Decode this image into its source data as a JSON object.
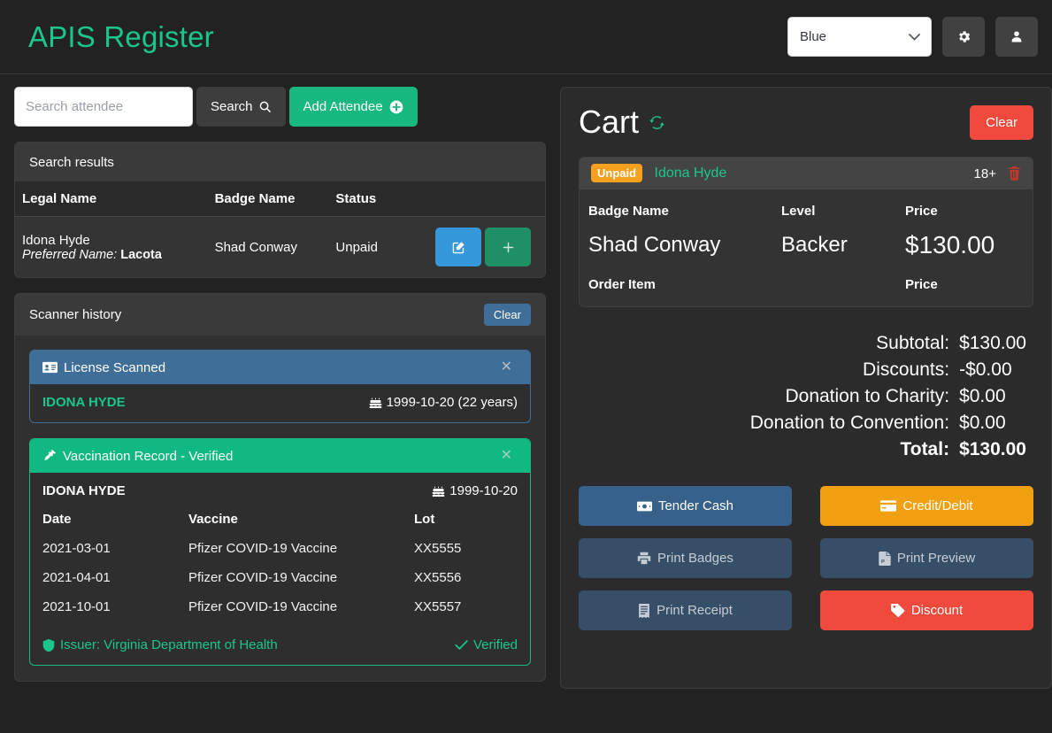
{
  "header": {
    "title": "APIS Register",
    "theme_select_value": "Blue",
    "theme_options": [
      "Blue"
    ],
    "settings_icon": "gear-icon",
    "account_icon": "user-icon"
  },
  "search": {
    "placeholder": "Search attendee",
    "value": "",
    "search_button": "Search",
    "search_icon": "magnifier-icon",
    "add_button": "Add Attendee",
    "add_icon": "plus-circle-icon"
  },
  "search_results": {
    "panel_title": "Search results",
    "columns": [
      "Legal Name",
      "Badge Name",
      "Status"
    ],
    "rows": [
      {
        "legal_name": "Idona Hyde",
        "preferred_label": "Preferred Name:",
        "preferred_name": "Lacota",
        "badge_name": "Shad Conway",
        "status": "Unpaid",
        "edit_icon": "pencil-square-icon",
        "add_icon": "plus-icon"
      }
    ]
  },
  "scanner_history": {
    "panel_title": "Scanner history",
    "clear_button": "Clear",
    "license_card": {
      "icon": "id-card-icon",
      "title": "License Scanned",
      "close_icon": "close-icon",
      "name": "IDONA HYDE",
      "dob_icon": "birthday-cake-icon",
      "dob": "1999-10-20 (22 years)"
    },
    "vaccine_card": {
      "icon": "syringe-icon",
      "title": "Vaccination Record - Verified",
      "close_icon": "close-icon",
      "name": "IDONA HYDE",
      "dob_icon": "birthday-cake-icon",
      "dob": "1999-10-20",
      "columns": [
        "Date",
        "Vaccine",
        "Lot"
      ],
      "records": [
        {
          "date": "2021-03-01",
          "vaccine": "Pfizer COVID-19 Vaccine",
          "lot": "XX5555"
        },
        {
          "date": "2021-04-01",
          "vaccine": "Pfizer COVID-19 Vaccine",
          "lot": "XX5556"
        },
        {
          "date": "2021-10-01",
          "vaccine": "Pfizer COVID-19 Vaccine",
          "lot": "XX5557"
        }
      ],
      "issuer_icon": "shield-icon",
      "issuer": "Issuer: Virginia Department of Health",
      "verified_icon": "check-icon",
      "verified": "Verified"
    }
  },
  "cart": {
    "title": "Cart",
    "sync_icon": "sync-icon",
    "clear_button": "Clear",
    "item": {
      "status_badge": "Unpaid",
      "attendee_name": "Idona Hyde",
      "age_flag": "18+",
      "delete_icon": "trash-icon",
      "columns": [
        "Badge Name",
        "Level",
        "Price"
      ],
      "badge_name": "Shad Conway",
      "level": "Backer",
      "price": "$130.00",
      "order_item_label": "Order Item",
      "order_price_label": "Price"
    },
    "totals": [
      {
        "label": "Subtotal:",
        "value": "$130.00"
      },
      {
        "label": "Discounts:",
        "value": "-$0.00"
      },
      {
        "label": "Donation to Charity:",
        "value": "$0.00"
      },
      {
        "label": "Donation to Convention:",
        "value": "$0.00"
      },
      {
        "label": "Total:",
        "value": "$130.00"
      }
    ],
    "actions": [
      {
        "label": "Tender Cash",
        "icon": "money-bill-icon",
        "style": "blue"
      },
      {
        "label": "Credit/Debit",
        "icon": "credit-card-icon",
        "style": "orange"
      },
      {
        "label": "Print Badges",
        "icon": "printer-icon",
        "style": "navy"
      },
      {
        "label": "Print Preview",
        "icon": "file-pdf-icon",
        "style": "navy"
      },
      {
        "label": "Print Receipt",
        "icon": "receipt-icon",
        "style": "navy"
      },
      {
        "label": "Discount",
        "icon": "tag-icon",
        "style": "red"
      }
    ]
  },
  "colors": {
    "brand_green": "#19c78d",
    "accent_blue": "#3f6e99",
    "warning_orange": "#f5a11d",
    "danger_red": "#ef4a3c",
    "page_bg": "#222222"
  }
}
